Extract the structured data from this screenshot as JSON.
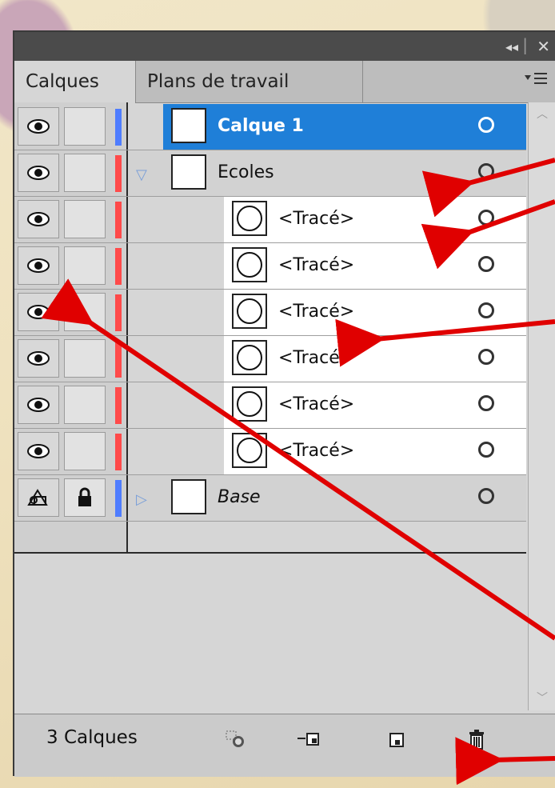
{
  "panel": {
    "titlebar": {
      "collapse_glyph": "◂◂",
      "close_glyph": "✕"
    },
    "tabs": [
      {
        "label": "Calques",
        "active": true
      },
      {
        "label": "Plans de travail",
        "active": false
      }
    ],
    "menu_icon": "panel-menu-icon"
  },
  "layers": [
    {
      "name": "Calque 1",
      "indent": 0,
      "selected": true,
      "twirl": "",
      "visible": true,
      "locked": false,
      "color": "#4f7dff"
    },
    {
      "name": "Ecoles",
      "indent": 0,
      "selected": false,
      "twirl": "open",
      "visible": true,
      "locked": false,
      "color": "#ff4a4a"
    },
    {
      "name": "<Tracé>",
      "indent": 1,
      "selected": false,
      "twirl": "",
      "visible": true,
      "locked": false,
      "color": "#ff4a4a"
    },
    {
      "name": "<Tracé>",
      "indent": 1,
      "selected": false,
      "twirl": "",
      "visible": true,
      "locked": false,
      "color": "#ff4a4a"
    },
    {
      "name": "<Tracé>",
      "indent": 1,
      "selected": false,
      "twirl": "",
      "visible": true,
      "locked": false,
      "color": "#ff4a4a"
    },
    {
      "name": "<Tracé>",
      "indent": 1,
      "selected": false,
      "twirl": "",
      "visible": true,
      "locked": false,
      "color": "#ff4a4a"
    },
    {
      "name": "<Tracé>",
      "indent": 1,
      "selected": false,
      "twirl": "",
      "visible": true,
      "locked": false,
      "color": "#ff4a4a"
    },
    {
      "name": "<Tracé>",
      "indent": 1,
      "selected": false,
      "twirl": "",
      "visible": true,
      "locked": false,
      "color": "#ff4a4a"
    },
    {
      "name": "Base",
      "indent": 0,
      "selected": false,
      "twirl": "closed",
      "visible": false,
      "locked": true,
      "color": "#4f7dff"
    }
  ],
  "footer": {
    "count_label": "3 Calques",
    "icons": [
      "locate-object-icon",
      "make-clipping-mask-icon",
      "new-layer-icon",
      "delete-icon"
    ]
  },
  "colors": {
    "selection": "#1f7fd8",
    "annotation_arrow": "#e00000"
  }
}
